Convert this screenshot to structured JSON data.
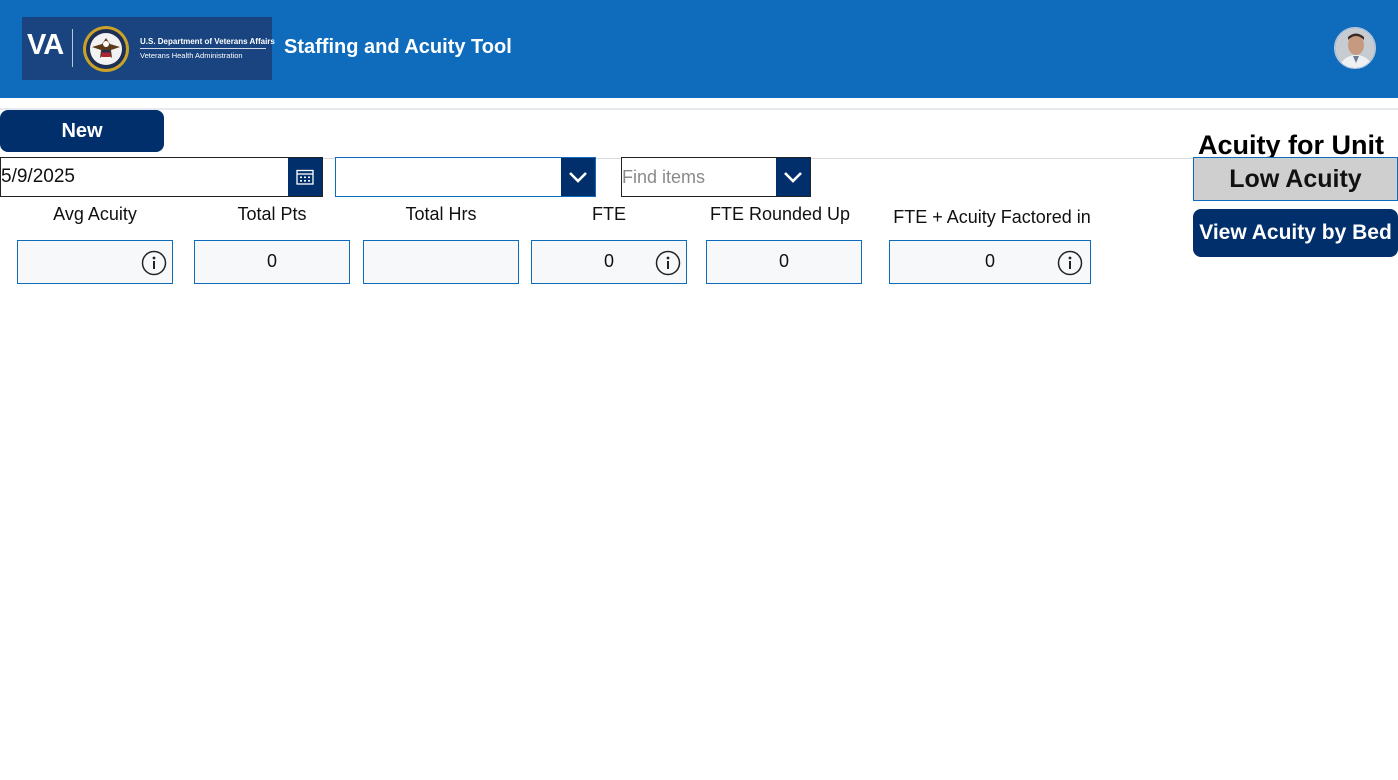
{
  "header": {
    "logo_va": "VA",
    "logo_department": "U.S. Department of Veterans Affairs",
    "logo_administration": "Veterans Health Administration",
    "app_title": "Staffing and Acuity Tool",
    "brand_color": "#0f6cbd"
  },
  "toolbar": {
    "new_label": "New",
    "date_value": "5/9/2025",
    "unit_dropdown_value": "",
    "find_placeholder": "Find items"
  },
  "metrics": {
    "avg_acuity": {
      "label": "Avg Acuity",
      "value": ""
    },
    "total_pts": {
      "label": "Total Pts",
      "value": "0"
    },
    "total_hrs": {
      "label": "Total Hrs",
      "value": ""
    },
    "fte": {
      "label": "FTE",
      "value": "0"
    },
    "fte_rounded_up": {
      "label": "FTE Rounded Up",
      "value": "0"
    },
    "fte_acuity_factored": {
      "label": "FTE + Acuity Factored in",
      "value": "0"
    }
  },
  "acuity": {
    "title": "Acuity for Unit",
    "level": "Low Acuity",
    "view_by_bed_label": "View Acuity by Bed"
  },
  "icons": {
    "calendar": "calendar-icon",
    "chevron": "chevron-down-icon",
    "info": "info-icon"
  }
}
